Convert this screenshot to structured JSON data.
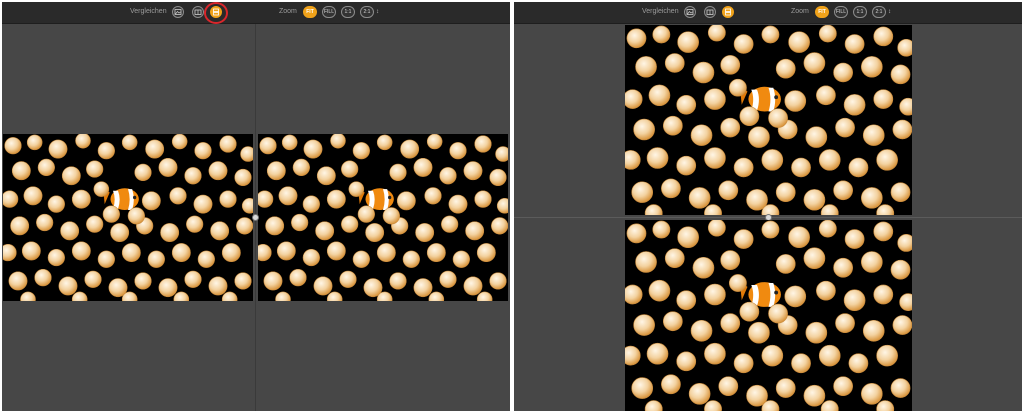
{
  "toolbar": {
    "compare_label": "Vergleichen",
    "zoom_label": "Zoom",
    "zoom_options": [
      "FIT",
      "FILL",
      "1:1",
      "2:1"
    ],
    "zoom_selected": "FIT",
    "spinner_glyph": "↕",
    "compare_modes": [
      "photo-compare-icon",
      "layers-compare-icon",
      "split-compare-icon"
    ]
  },
  "colors": {
    "accent": "#f0a21a",
    "highlight": "#d9262b",
    "pane_bg": "#474747",
    "toolbar_bg": "#2a2a2a"
  },
  "views": {
    "left": "Side-by-side comparison",
    "right": "Top-bottom comparison"
  }
}
